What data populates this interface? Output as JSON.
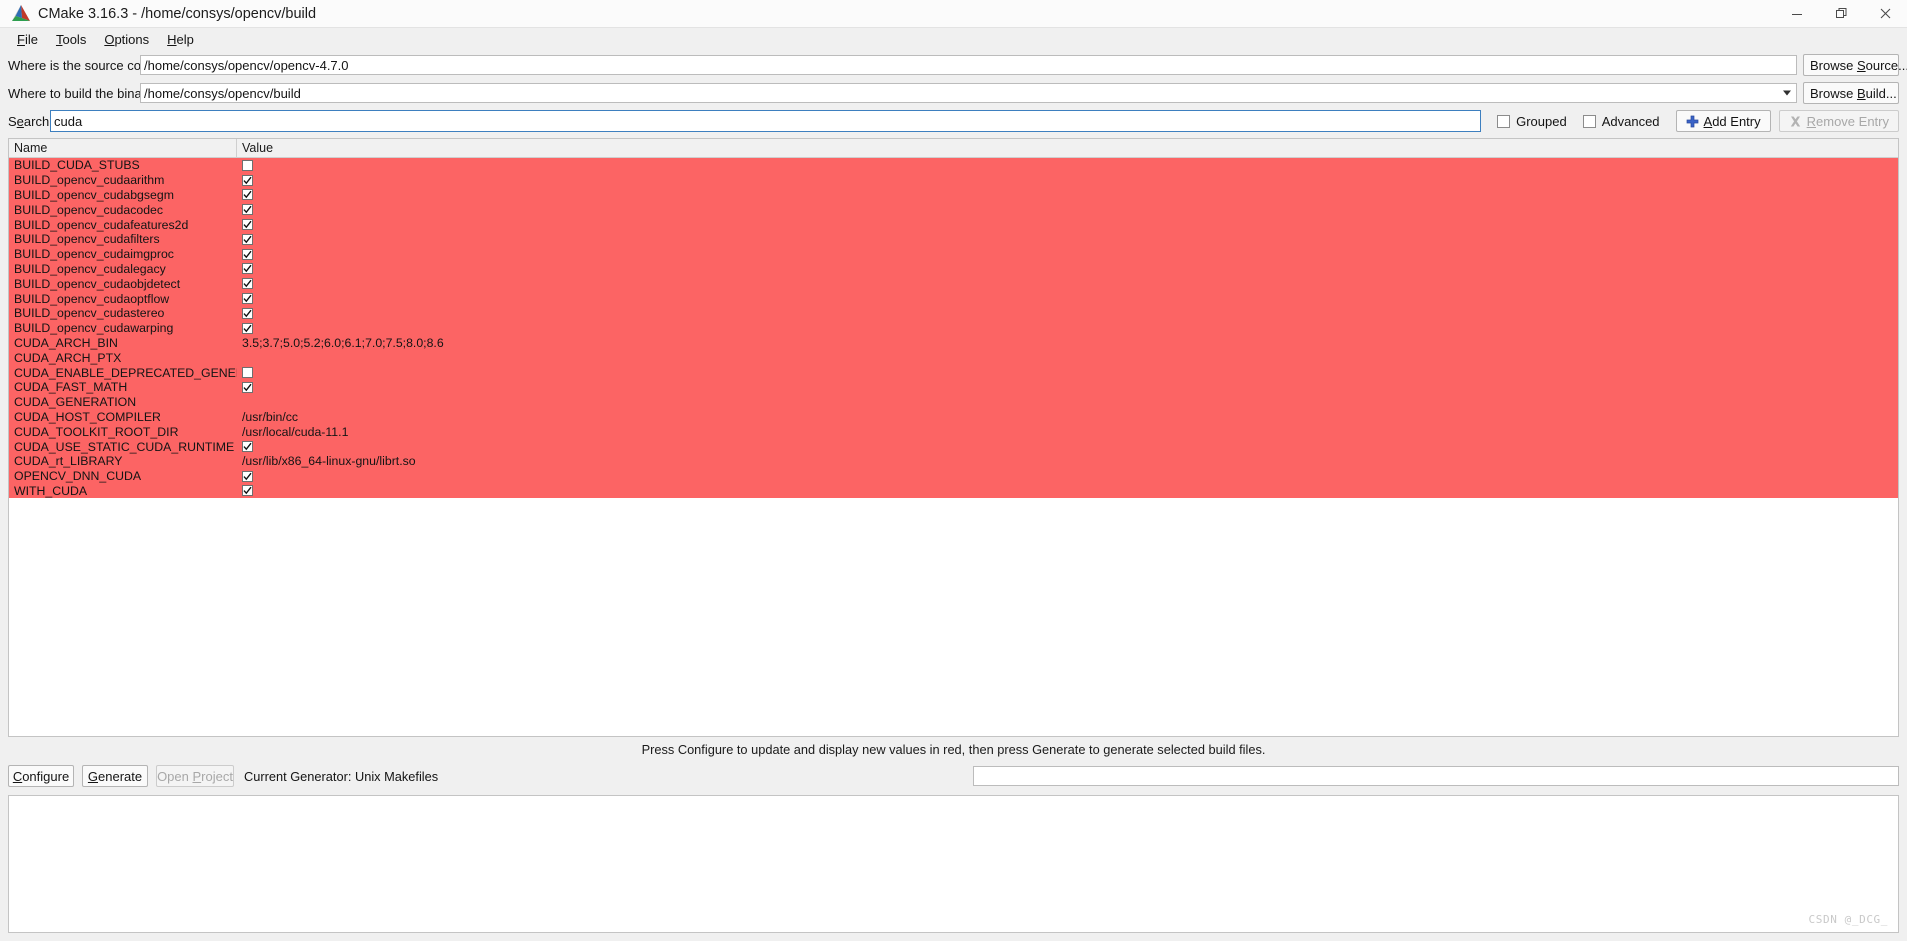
{
  "window": {
    "title": "CMake 3.16.3 - /home/consys/opencv/build",
    "logo_icon": "cmake-logo-icon",
    "controls": [
      {
        "name": "minimize",
        "icon": "minimize-icon"
      },
      {
        "name": "restore",
        "icon": "restore-icon"
      },
      {
        "name": "close",
        "icon": "close-icon"
      }
    ]
  },
  "menubar": {
    "items": [
      {
        "label": "File",
        "mnemonic": "F"
      },
      {
        "label": "Tools",
        "mnemonic": "T"
      },
      {
        "label": "Options",
        "mnemonic": "O"
      },
      {
        "label": "Help",
        "mnemonic": "H"
      }
    ]
  },
  "form": {
    "source_label": "Where is the source code:",
    "source_value": "/home/consys/opencv/opencv-4.7.0",
    "browse_source_label": "Browse Source...",
    "browse_source_mnemonic": "S",
    "build_label": "Where to build the binaries:",
    "build_value": "/home/consys/opencv/build",
    "browse_build_label": "Browse Build...",
    "browse_build_mnemonic": "B",
    "search_label": "Search:",
    "search_mnemonic": "e",
    "search_value": "cuda",
    "grouped_label": "Grouped",
    "grouped_checked": false,
    "advanced_label": "Advanced",
    "advanced_checked": false,
    "add_entry_label": "Add Entry",
    "add_entry_mnemonic": "A",
    "add_entry_icon": "plus-icon",
    "remove_entry_label": "Remove Entry",
    "remove_entry_mnemonic": "R",
    "remove_entry_icon": "remove-x-icon",
    "remove_entry_enabled": false
  },
  "cache_table": {
    "columns": [
      "Name",
      "Value"
    ],
    "row_highlight_color": "#fc6464",
    "rows": [
      {
        "name": "BUILD_CUDA_STUBS",
        "type": "bool",
        "checked": false
      },
      {
        "name": "BUILD_opencv_cudaarithm",
        "type": "bool",
        "checked": true
      },
      {
        "name": "BUILD_opencv_cudabgsegm",
        "type": "bool",
        "checked": true
      },
      {
        "name": "BUILD_opencv_cudacodec",
        "type": "bool",
        "checked": true
      },
      {
        "name": "BUILD_opencv_cudafeatures2d",
        "type": "bool",
        "checked": true
      },
      {
        "name": "BUILD_opencv_cudafilters",
        "type": "bool",
        "checked": true
      },
      {
        "name": "BUILD_opencv_cudaimgproc",
        "type": "bool",
        "checked": true
      },
      {
        "name": "BUILD_opencv_cudalegacy",
        "type": "bool",
        "checked": true
      },
      {
        "name": "BUILD_opencv_cudaobjdetect",
        "type": "bool",
        "checked": true
      },
      {
        "name": "BUILD_opencv_cudaoptflow",
        "type": "bool",
        "checked": true
      },
      {
        "name": "BUILD_opencv_cudastereo",
        "type": "bool",
        "checked": true
      },
      {
        "name": "BUILD_opencv_cudawarping",
        "type": "bool",
        "checked": true
      },
      {
        "name": "CUDA_ARCH_BIN",
        "type": "text",
        "value": "3.5;3.7;5.0;5.2;6.0;6.1;7.0;7.5;8.0;8.6"
      },
      {
        "name": "CUDA_ARCH_PTX",
        "type": "text",
        "value": ""
      },
      {
        "name": "CUDA_ENABLE_DEPRECATED_GENERATION",
        "type": "bool",
        "checked": false
      },
      {
        "name": "CUDA_FAST_MATH",
        "type": "bool",
        "checked": true
      },
      {
        "name": "CUDA_GENERATION",
        "type": "text",
        "value": ""
      },
      {
        "name": "CUDA_HOST_COMPILER",
        "type": "text",
        "value": "/usr/bin/cc"
      },
      {
        "name": "CUDA_TOOLKIT_ROOT_DIR",
        "type": "text",
        "value": "/usr/local/cuda-11.1"
      },
      {
        "name": "CUDA_USE_STATIC_CUDA_RUNTIME",
        "type": "bool",
        "checked": true
      },
      {
        "name": "CUDA_rt_LIBRARY",
        "type": "text",
        "value": "/usr/lib/x86_64-linux-gnu/librt.so"
      },
      {
        "name": "OPENCV_DNN_CUDA",
        "type": "bool",
        "checked": true
      },
      {
        "name": "WITH_CUDA",
        "type": "bool",
        "checked": true
      }
    ]
  },
  "status": {
    "message": "Press Configure to update and display new values in red, then press Generate to generate selected build files."
  },
  "actions": {
    "configure_label": "Configure",
    "configure_mnemonic": "C",
    "generate_label": "Generate",
    "generate_mnemonic": "G",
    "open_project_label": "Open Project",
    "open_project_mnemonic": "P",
    "open_project_enabled": false,
    "generator_label": "Current Generator: Unix Makefiles"
  },
  "output": {
    "text": "",
    "watermark": "CSDN @_DCG_"
  }
}
